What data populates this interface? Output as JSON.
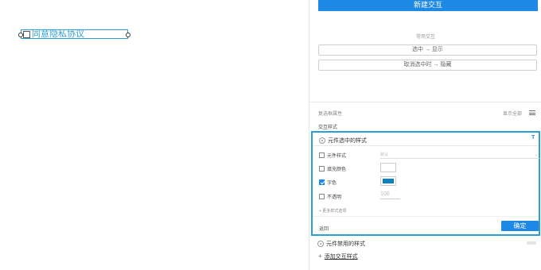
{
  "canvas": {
    "widget_label": "同意隐私协议"
  },
  "panel": {
    "new_interaction_button": "新建交互",
    "common_interactions_label": "常用交互",
    "actions": [
      "选中 → 显示",
      "取消选中时 → 隐藏"
    ],
    "checkbox_props_label": "复选框属性",
    "show_all_label": "显示全部",
    "interaction_styles_label": "交互样式",
    "selected_style": {
      "title": "元件选中的样式",
      "t_icon": "T",
      "rows": {
        "widget_style": "元件样式",
        "fill_color": "填充颜色",
        "font_color": "字色",
        "opacity": "不透明"
      },
      "widget_style_placeholder": "默认",
      "opacity_value": "100",
      "more_options": "+ 更多样式选项",
      "back": "返回",
      "ok": "确定",
      "font_color_value": "#0b7fc0"
    },
    "disabled_style_title": "元件禁用的样式",
    "add_style_label": "添加交互样式"
  },
  "colors": {
    "accent": "#1e88e5",
    "selection": "#2b9fd8"
  }
}
